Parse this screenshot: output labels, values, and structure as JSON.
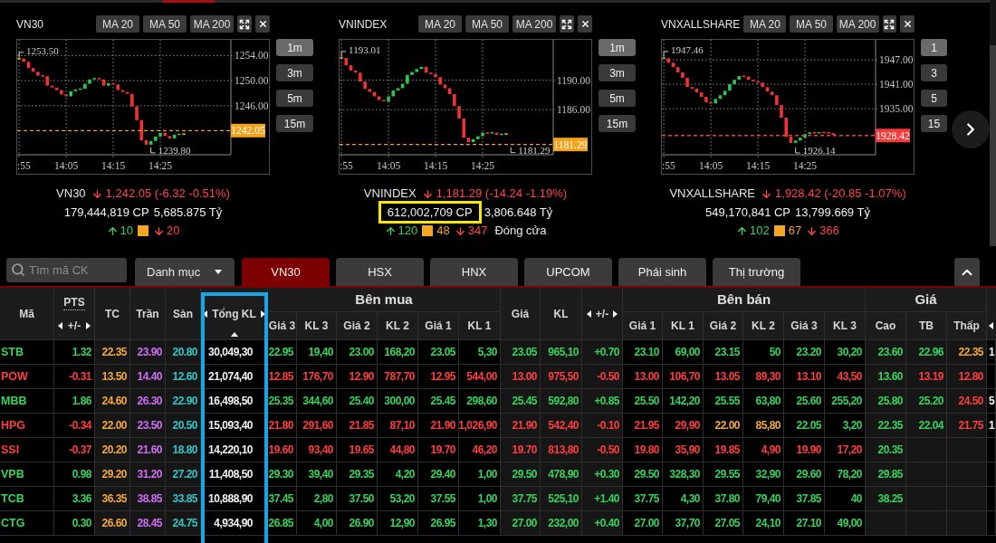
{
  "chart_panels": [
    {
      "title": "VN30",
      "ma_buttons": [
        "MA 20",
        "MA 50",
        "MA 200"
      ],
      "chart": {
        "y_labels": [
          "1254.00",
          "1250.00",
          "1246.00"
        ],
        "x_labels": [
          ":55",
          "14:05",
          "14:15",
          "14:25"
        ],
        "high_label": "1253.50",
        "low_label": "1239.80",
        "price_tag": {
          "label": "1242.05",
          "color": "#f5a31a"
        }
      },
      "timeframes": [
        {
          "label": "1m",
          "selected": true
        },
        {
          "label": "3m",
          "selected": false
        },
        {
          "label": "5m",
          "selected": false
        },
        {
          "label": "15m",
          "selected": false
        }
      ],
      "summary": {
        "name": "VN30",
        "falling": true,
        "change": "1,242.05 (-6.32 -0.51%)",
        "volume": "179,444,819 CP",
        "volume_highlighted": false,
        "value": "5,685.875 Tỷ",
        "advancers": "10",
        "decliners": "20"
      }
    },
    {
      "title": "VNINDEX",
      "ma_buttons": [
        "MA 20",
        "MA 50",
        "MA 200"
      ],
      "chart": {
        "y_labels": [
          "1190.00",
          "1186.00"
        ],
        "x_labels": [
          ":55",
          "14:05",
          "14:15",
          "14:25"
        ],
        "high_label": "1193.01",
        "low_label": "1181.29",
        "price_tag": {
          "label": "1181.29",
          "color": "#f5a31a"
        }
      },
      "timeframes": [
        {
          "label": "1m",
          "selected": true
        },
        {
          "label": "3m",
          "selected": false
        },
        {
          "label": "5m",
          "selected": false
        },
        {
          "label": "15m",
          "selected": false
        }
      ],
      "summary": {
        "name": "VNINDEX",
        "falling": true,
        "change": "1,181.29 (-14.24 -1.19%)",
        "volume": "612,002,709 CP",
        "volume_highlighted": true,
        "value": "3,806.648 Tỷ",
        "advancers": "120",
        "unchanged": "48",
        "decliners": "347",
        "session": "Đóng cửa"
      }
    },
    {
      "title": "VNXALLSHARE",
      "ma_buttons": [
        "MA 20",
        "MA 50",
        "MA 200"
      ],
      "chart": {
        "y_labels": [
          "1947.00",
          "1941.00",
          "1935.00"
        ],
        "x_labels": [
          ":55",
          "14:05",
          "14:15",
          "14:25"
        ],
        "high_label": "1947.46",
        "low_label": "1926.14",
        "price_tag": {
          "label": "1928.42",
          "color": "#f23b3b"
        }
      },
      "timeframes": [
        {
          "label": "1",
          "selected": true
        },
        {
          "label": "3",
          "selected": false
        },
        {
          "label": "5",
          "selected": false
        },
        {
          "label": "15",
          "selected": false
        }
      ],
      "summary": {
        "name": "VNXALLSHARE",
        "falling": true,
        "change": "1,928.42 (-20.85 -1.07%)",
        "volume": "549,170,841 CP",
        "volume_highlighted": false,
        "value": "13,799.669 Tỷ",
        "advancers": "102",
        "unchanged": "67",
        "decliners": "366"
      }
    }
  ],
  "toolbar": {
    "search": {
      "placeholder": "Tìm mã CK"
    },
    "category_dropdown": {
      "label": "Danh mục"
    },
    "tabs": [
      {
        "label": "VN30",
        "selected": true
      },
      {
        "label": "HSX",
        "selected": false
      },
      {
        "label": "HNX",
        "selected": false
      },
      {
        "label": "UPCOM",
        "selected": false
      },
      {
        "label": "Phái sinh",
        "selected": false
      },
      {
        "label": "Thị trường",
        "selected": false
      }
    ]
  },
  "table": {
    "header": [
      {
        "kind": "single",
        "label": "Mã"
      },
      {
        "kind": "split",
        "label": "PTS",
        "sub_label": "+/-"
      },
      {
        "kind": "single",
        "label": "TC"
      },
      {
        "kind": "single",
        "label": "Trần"
      },
      {
        "kind": "single",
        "label": "Sàn"
      },
      {
        "kind": "scroll",
        "label": "Tổng KL",
        "highlighted": true,
        "sorted": true
      },
      {
        "kind": "group",
        "label": "Bên mua",
        "columns": [
          "Giá 3",
          "KL 3",
          "Giá 2",
          "KL 2",
          "Giá 1",
          "KL 1"
        ]
      },
      {
        "kind": "single",
        "label": "Giá"
      },
      {
        "kind": "single",
        "label": "KL"
      },
      {
        "kind": "scroll",
        "label": "+/-"
      },
      {
        "kind": "group",
        "label": "Bên bán",
        "columns": [
          "Giá 1",
          "KL 1",
          "Giá 2",
          "KL 2",
          "Giá 3",
          "KL 3"
        ]
      },
      {
        "kind": "group",
        "label": "Giá",
        "columns": [
          "Cao",
          "TB",
          "Thấp"
        ]
      },
      {
        "kind": "edge"
      }
    ],
    "rows": [
      {
        "cells": [
          {
            "text": "STB",
            "color": "#36d35b"
          },
          {
            "text": "1.32",
            "color": "#36d35b"
          },
          {
            "text": "22.35",
            "color": "#f3a83c"
          },
          {
            "text": "23.90",
            "color": "#cd6ff4"
          },
          {
            "text": "20.80",
            "color": "#33c6c6"
          },
          {
            "text": "30,049,30",
            "color": "#f2f2f2"
          },
          {
            "text": "22.95",
            "color": "#36d35b"
          },
          {
            "text": "19,40",
            "color": "#36d35b"
          },
          {
            "text": "23.00",
            "color": "#36d35b"
          },
          {
            "text": "168,20",
            "color": "#36d35b"
          },
          {
            "text": "23.05",
            "color": "#36d35b"
          },
          {
            "text": "5,30",
            "color": "#36d35b"
          },
          {
            "text": "23.05",
            "color": "#36d35b"
          },
          {
            "text": "965,10",
            "color": "#36d35b"
          },
          {
            "text": "+0.70",
            "color": "#36d35b"
          },
          {
            "text": "23.10",
            "color": "#36d35b"
          },
          {
            "text": "69,00",
            "color": "#36d35b"
          },
          {
            "text": "23.15",
            "color": "#36d35b"
          },
          {
            "text": "50",
            "color": "#36d35b"
          },
          {
            "text": "23.20",
            "color": "#36d35b"
          },
          {
            "text": "30,20",
            "color": "#36d35b"
          },
          {
            "text": "23.60",
            "color": "#36d35b"
          },
          {
            "text": "22.96",
            "color": "#36d35b"
          },
          {
            "text": "22.35",
            "color": "#f3a83c"
          },
          {
            "text": "1",
            "color": "#f2f2f2"
          }
        ]
      },
      {
        "cells": [
          {
            "text": "POW",
            "color": "#ff3d3d"
          },
          {
            "text": "-0.31",
            "color": "#ff3d3d"
          },
          {
            "text": "13.50",
            "color": "#f3a83c"
          },
          {
            "text": "14.40",
            "color": "#cd6ff4"
          },
          {
            "text": "12.60",
            "color": "#33c6c6"
          },
          {
            "text": "21,074,40",
            "color": "#f2f2f2"
          },
          {
            "text": "12.85",
            "color": "#ff3d3d"
          },
          {
            "text": "176,70",
            "color": "#ff3d3d"
          },
          {
            "text": "12.90",
            "color": "#ff3d3d"
          },
          {
            "text": "787,70",
            "color": "#ff3d3d"
          },
          {
            "text": "12.95",
            "color": "#ff3d3d"
          },
          {
            "text": "544,00",
            "color": "#ff3d3d"
          },
          {
            "text": "13.00",
            "color": "#ff3d3d"
          },
          {
            "text": "975,50",
            "color": "#ff3d3d"
          },
          {
            "text": "-0.50",
            "color": "#ff3d3d"
          },
          {
            "text": "13.00",
            "color": "#ff3d3d"
          },
          {
            "text": "106,70",
            "color": "#ff3d3d"
          },
          {
            "text": "13.05",
            "color": "#ff3d3d"
          },
          {
            "text": "89,30",
            "color": "#ff3d3d"
          },
          {
            "text": "13.10",
            "color": "#ff3d3d"
          },
          {
            "text": "43,50",
            "color": "#ff3d3d"
          },
          {
            "text": "13.60",
            "color": "#36d35b"
          },
          {
            "text": "13.19",
            "color": "#ff3d3d"
          },
          {
            "text": "12.80",
            "color": "#ff3d3d"
          }
        ]
      },
      {
        "cells": [
          {
            "text": "MBB",
            "color": "#36d35b"
          },
          {
            "text": "1.86",
            "color": "#36d35b"
          },
          {
            "text": "24.60",
            "color": "#f3a83c"
          },
          {
            "text": "26.30",
            "color": "#cd6ff4"
          },
          {
            "text": "22.90",
            "color": "#33c6c6"
          },
          {
            "text": "16,498,50",
            "color": "#f2f2f2"
          },
          {
            "text": "25.35",
            "color": "#36d35b"
          },
          {
            "text": "344,60",
            "color": "#36d35b"
          },
          {
            "text": "25.40",
            "color": "#36d35b"
          },
          {
            "text": "300,00",
            "color": "#36d35b"
          },
          {
            "text": "25.45",
            "color": "#36d35b"
          },
          {
            "text": "298,60",
            "color": "#36d35b"
          },
          {
            "text": "25.45",
            "color": "#36d35b"
          },
          {
            "text": "592,80",
            "color": "#36d35b"
          },
          {
            "text": "+0.85",
            "color": "#36d35b"
          },
          {
            "text": "25.50",
            "color": "#36d35b"
          },
          {
            "text": "142,20",
            "color": "#36d35b"
          },
          {
            "text": "25.55",
            "color": "#36d35b"
          },
          {
            "text": "63,80",
            "color": "#36d35b"
          },
          {
            "text": "25.60",
            "color": "#36d35b"
          },
          {
            "text": "255,20",
            "color": "#36d35b"
          },
          {
            "text": "25.80",
            "color": "#36d35b"
          },
          {
            "text": "25.20",
            "color": "#36d35b"
          },
          {
            "text": "24.50",
            "color": "#ff3d3d"
          },
          {
            "text": "5",
            "color": "#f2f2f2"
          }
        ]
      },
      {
        "cells": [
          {
            "text": "HPG",
            "color": "#ff3d3d"
          },
          {
            "text": "-0.34",
            "color": "#ff3d3d"
          },
          {
            "text": "22.00",
            "color": "#f3a83c"
          },
          {
            "text": "23.50",
            "color": "#cd6ff4"
          },
          {
            "text": "20.50",
            "color": "#33c6c6"
          },
          {
            "text": "15,093,40",
            "color": "#f2f2f2"
          },
          {
            "text": "21.80",
            "color": "#ff3d3d"
          },
          {
            "text": "291,60",
            "color": "#ff3d3d"
          },
          {
            "text": "21.85",
            "color": "#ff3d3d"
          },
          {
            "text": "87,10",
            "color": "#ff3d3d"
          },
          {
            "text": "21.90",
            "color": "#ff3d3d"
          },
          {
            "text": "1,026,90",
            "color": "#ff3d3d"
          },
          {
            "text": "21.90",
            "color": "#ff3d3d"
          },
          {
            "text": "542,40",
            "color": "#ff3d3d"
          },
          {
            "text": "-0.10",
            "color": "#ff3d3d"
          },
          {
            "text": "21.95",
            "color": "#ff3d3d"
          },
          {
            "text": "29,90",
            "color": "#ff3d3d"
          },
          {
            "text": "22.00",
            "color": "#f3a83c"
          },
          {
            "text": "85,80",
            "color": "#f3a83c"
          },
          {
            "text": "22.05",
            "color": "#36d35b"
          },
          {
            "text": "3,20",
            "color": "#36d35b"
          },
          {
            "text": "22.35",
            "color": "#36d35b"
          },
          {
            "text": "22.04",
            "color": "#36d35b"
          },
          {
            "text": "21.75",
            "color": "#ff3d3d"
          },
          {
            "text": "1",
            "color": "#f2f2f2"
          }
        ]
      },
      {
        "cells": [
          {
            "text": "SSI",
            "color": "#ff3d3d"
          },
          {
            "text": "-0.37",
            "color": "#ff3d3d"
          },
          {
            "text": "20.20",
            "color": "#f3a83c"
          },
          {
            "text": "21.60",
            "color": "#cd6ff4"
          },
          {
            "text": "18.80",
            "color": "#33c6c6"
          },
          {
            "text": "14,220,10",
            "color": "#f2f2f2"
          },
          {
            "text": "19.60",
            "color": "#ff3d3d"
          },
          {
            "text": "93,40",
            "color": "#ff3d3d"
          },
          {
            "text": "19.65",
            "color": "#ff3d3d"
          },
          {
            "text": "44,80",
            "color": "#ff3d3d"
          },
          {
            "text": "19.70",
            "color": "#ff3d3d"
          },
          {
            "text": "46,20",
            "color": "#ff3d3d"
          },
          {
            "text": "19.70",
            "color": "#ff3d3d"
          },
          {
            "text": "813,80",
            "color": "#ff3d3d"
          },
          {
            "text": "-0.50",
            "color": "#ff3d3d"
          },
          {
            "text": "19.80",
            "color": "#ff3d3d"
          },
          {
            "text": "35,90",
            "color": "#ff3d3d"
          },
          {
            "text": "19.85",
            "color": "#ff3d3d"
          },
          {
            "text": "4,90",
            "color": "#ff3d3d"
          },
          {
            "text": "19.90",
            "color": "#ff3d3d"
          },
          {
            "text": "17,20",
            "color": "#ff3d3d"
          },
          {
            "text": "20.35",
            "color": "#36d35b"
          }
        ]
      },
      {
        "cells": [
          {
            "text": "VPB",
            "color": "#36d35b"
          },
          {
            "text": "0.98",
            "color": "#36d35b"
          },
          {
            "text": "29.20",
            "color": "#f3a83c"
          },
          {
            "text": "31.20",
            "color": "#cd6ff4"
          },
          {
            "text": "27.20",
            "color": "#33c6c6"
          },
          {
            "text": "11,408,50",
            "color": "#f2f2f2"
          },
          {
            "text": "29.30",
            "color": "#36d35b"
          },
          {
            "text": "39,40",
            "color": "#36d35b"
          },
          {
            "text": "29.35",
            "color": "#36d35b"
          },
          {
            "text": "4,20",
            "color": "#36d35b"
          },
          {
            "text": "29.40",
            "color": "#36d35b"
          },
          {
            "text": "1,00",
            "color": "#36d35b"
          },
          {
            "text": "29.50",
            "color": "#36d35b"
          },
          {
            "text": "478,90",
            "color": "#36d35b"
          },
          {
            "text": "+0.30",
            "color": "#36d35b"
          },
          {
            "text": "29.50",
            "color": "#36d35b"
          },
          {
            "text": "328,30",
            "color": "#36d35b"
          },
          {
            "text": "29.55",
            "color": "#36d35b"
          },
          {
            "text": "32,90",
            "color": "#36d35b"
          },
          {
            "text": "29.60",
            "color": "#36d35b"
          },
          {
            "text": "78,20",
            "color": "#36d35b"
          },
          {
            "text": "29.85",
            "color": "#36d35b"
          }
        ]
      },
      {
        "cells": [
          {
            "text": "TCB",
            "color": "#36d35b"
          },
          {
            "text": "3.36",
            "color": "#36d35b"
          },
          {
            "text": "36.35",
            "color": "#f3a83c"
          },
          {
            "text": "38.85",
            "color": "#cd6ff4"
          },
          {
            "text": "33.85",
            "color": "#33c6c6"
          },
          {
            "text": "10,888,90",
            "color": "#f2f2f2"
          },
          {
            "text": "37.45",
            "color": "#36d35b"
          },
          {
            "text": "2,80",
            "color": "#36d35b"
          },
          {
            "text": "37.50",
            "color": "#36d35b"
          },
          {
            "text": "53,20",
            "color": "#36d35b"
          },
          {
            "text": "37.55",
            "color": "#36d35b"
          },
          {
            "text": "1,00",
            "color": "#36d35b"
          },
          {
            "text": "37.75",
            "color": "#36d35b"
          },
          {
            "text": "525,10",
            "color": "#36d35b"
          },
          {
            "text": "+1.40",
            "color": "#36d35b"
          },
          {
            "text": "37.75",
            "color": "#36d35b"
          },
          {
            "text": "4,30",
            "color": "#36d35b"
          },
          {
            "text": "37.80",
            "color": "#36d35b"
          },
          {
            "text": "79,40",
            "color": "#36d35b"
          },
          {
            "text": "37.85",
            "color": "#36d35b"
          },
          {
            "text": "40",
            "color": "#36d35b"
          },
          {
            "text": "38.25",
            "color": "#36d35b"
          }
        ]
      },
      {
        "cells": [
          {
            "text": "CTG",
            "color": "#36d35b"
          },
          {
            "text": "0.30",
            "color": "#36d35b"
          },
          {
            "text": "26.60",
            "color": "#f3a83c"
          },
          {
            "text": "28.45",
            "color": "#cd6ff4"
          },
          {
            "text": "24.75",
            "color": "#33c6c6"
          },
          {
            "text": "4,934,90",
            "color": "#f2f2f2"
          },
          {
            "text": "26.85",
            "color": "#36d35b"
          },
          {
            "text": "4,00",
            "color": "#36d35b"
          },
          {
            "text": "26.90",
            "color": "#36d35b"
          },
          {
            "text": "12,90",
            "color": "#36d35b"
          },
          {
            "text": "26.95",
            "color": "#36d35b"
          },
          {
            "text": "1,30",
            "color": "#36d35b"
          },
          {
            "text": "27.00",
            "color": "#36d35b"
          },
          {
            "text": "232,00",
            "color": "#36d35b"
          },
          {
            "text": "+0.40",
            "color": "#36d35b"
          },
          {
            "text": "27.00",
            "color": "#36d35b"
          },
          {
            "text": "37,70",
            "color": "#36d35b"
          },
          {
            "text": "27.05",
            "color": "#36d35b"
          },
          {
            "text": "24,10",
            "color": "#36d35b"
          },
          {
            "text": "27.10",
            "color": "#36d35b"
          },
          {
            "text": "49,00",
            "color": "#36d35b"
          }
        ]
      }
    ]
  }
}
